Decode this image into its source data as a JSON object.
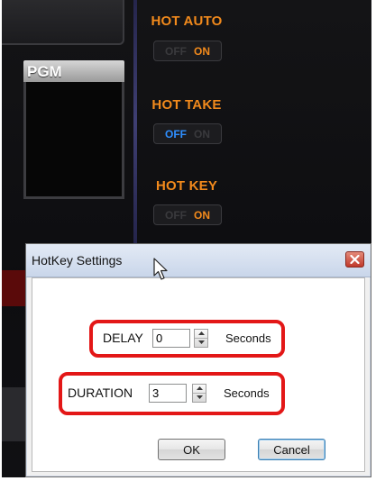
{
  "background_app": {
    "pgm_label": "PGM",
    "hot_auto": {
      "label": "HOT AUTO",
      "off": "OFF",
      "on": "ON",
      "active": "ON"
    },
    "hot_take": {
      "label": "HOT TAKE",
      "off": "OFF",
      "on": "ON",
      "active": "OFF"
    },
    "hot_key": {
      "label": "HOT KEY",
      "off": "OFF",
      "on": "ON",
      "active": "ON"
    }
  },
  "dialog": {
    "title": "HotKey Settings",
    "close_icon": "close-x-icon",
    "delay": {
      "label": "DELAY",
      "value": "0",
      "units": "Seconds"
    },
    "duration": {
      "label": "DURATION",
      "value": "3",
      "units": "Seconds"
    },
    "ok_label": "OK",
    "cancel_label": "Cancel"
  },
  "colors": {
    "accent_orange": "#f28a1c",
    "active_blue": "#2f8fff",
    "highlight_red": "#e31717",
    "close_red": "#c0392b"
  }
}
